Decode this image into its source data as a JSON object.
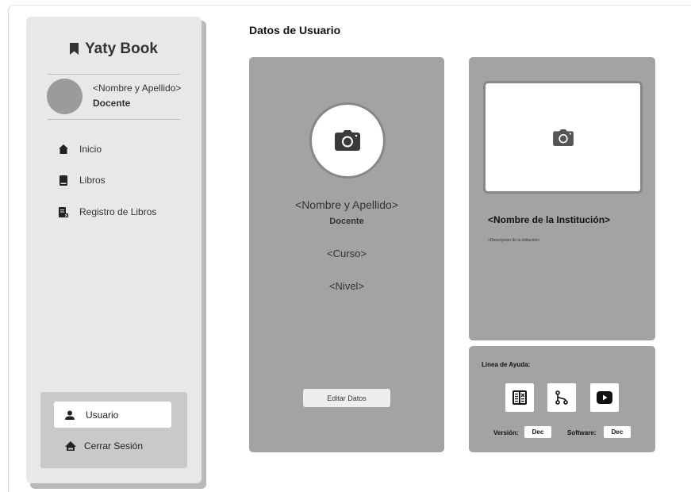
{
  "sidebar": {
    "brand": "Yaty Book",
    "user": {
      "name": "<Nombre y Apellido>",
      "role": "Docente"
    },
    "nav": [
      {
        "label": "Inicio",
        "icon": "home-icon"
      },
      {
        "label": "Libros",
        "icon": "book-icon"
      },
      {
        "label": "Registro de Libros",
        "icon": "book-register-icon"
      }
    ],
    "bottom": {
      "active_label": "Usuario",
      "logout_label": "Cerrar Sesión"
    }
  },
  "main": {
    "title": "Datos de Usuario",
    "profile": {
      "name": "<Nombre y Apellido>",
      "role": "Docente",
      "course": "<Curso>",
      "level": "<Nivel>",
      "edit_label": "Editar Datos"
    },
    "institution": {
      "name": "<Nombre de la Institución>",
      "description": "<Descripcion de la intitución>"
    },
    "help": {
      "title": "Linea de Ayuda:",
      "icons": [
        "manual-icon",
        "git-branch-icon",
        "youtube-icon"
      ],
      "version_label": "Versión:",
      "version_value": "Dec",
      "software_label": "Software:",
      "software_value": "Dec"
    }
  },
  "colors": {
    "card_gray": "#a3a3a3",
    "sidebar_bg": "#e8e8e8",
    "sidebar_bottom": "#c9c9c9"
  }
}
